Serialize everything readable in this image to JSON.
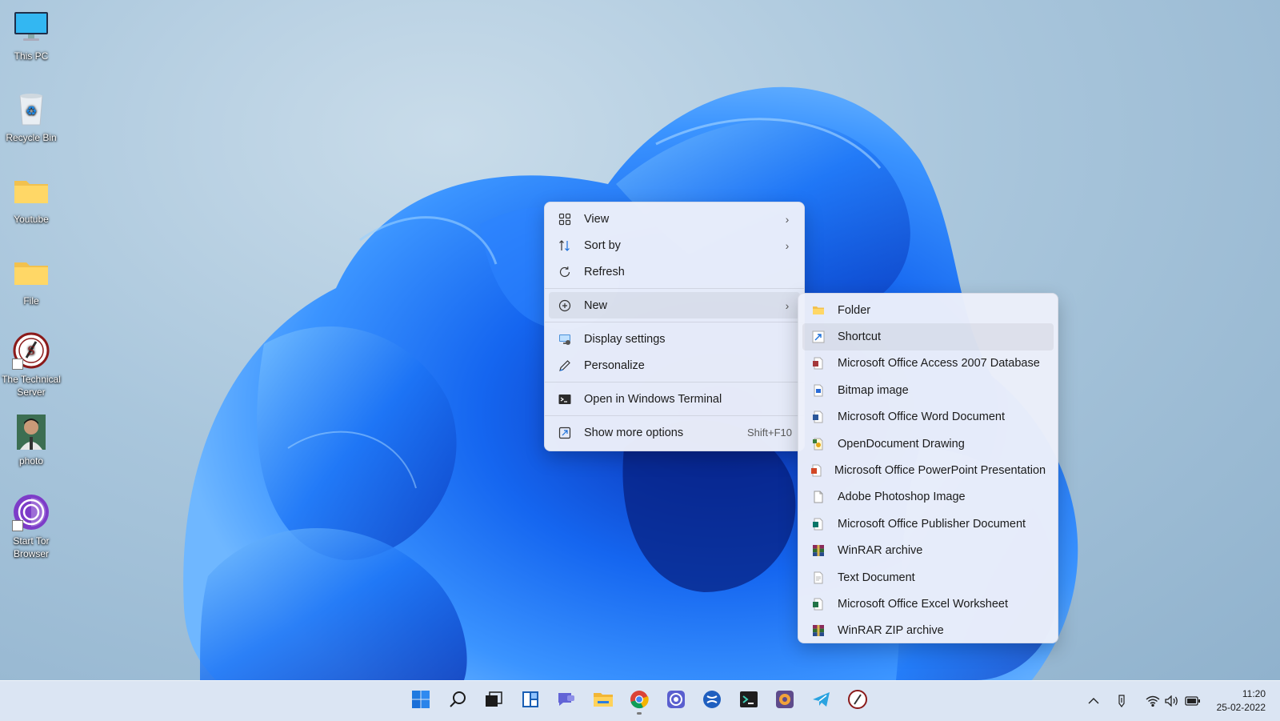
{
  "desktop": {
    "icons": [
      {
        "label": "This PC",
        "icon": "monitor-icon"
      },
      {
        "label": "Recycle Bin",
        "icon": "recycle-bin-icon"
      },
      {
        "label": "Youtube",
        "icon": "folder-icon"
      },
      {
        "label": "File",
        "icon": "folder-icon"
      },
      {
        "label": "The Technical Server",
        "icon": "technical-server-logo-icon"
      },
      {
        "label": "photo",
        "icon": "photo-thumbnail-icon"
      },
      {
        "label": "Start Tor Browser",
        "icon": "tor-browser-icon"
      }
    ]
  },
  "context_menu": {
    "items": [
      {
        "label": "View",
        "icon": "grid-icon",
        "submenu": true
      },
      {
        "label": "Sort by",
        "icon": "sort-icon",
        "submenu": true
      },
      {
        "label": "Refresh",
        "icon": "refresh-icon",
        "submenu": false
      },
      {
        "label": "New",
        "icon": "plus-circle-icon",
        "submenu": true
      },
      {
        "label": "Display settings",
        "icon": "display-icon",
        "submenu": false
      },
      {
        "label": "Personalize",
        "icon": "pen-icon",
        "submenu": false
      },
      {
        "label": "Open in Windows Terminal",
        "icon": "terminal-icon",
        "submenu": false
      },
      {
        "label": "Show more options",
        "icon": "more-options-icon",
        "accelerator": "Shift+F10"
      }
    ]
  },
  "new_submenu": {
    "items": [
      {
        "label": "Folder",
        "icon": "folder-icon"
      },
      {
        "label": "Shortcut",
        "icon": "shortcut-icon"
      },
      {
        "label": "Microsoft Office Access 2007 Database",
        "icon": "access-file-icon"
      },
      {
        "label": "Bitmap image",
        "icon": "bitmap-file-icon"
      },
      {
        "label": "Microsoft Office Word Document",
        "icon": "word-file-icon"
      },
      {
        "label": "OpenDocument Drawing",
        "icon": "opendocument-drawing-icon"
      },
      {
        "label": "Microsoft Office PowerPoint Presentation",
        "icon": "powerpoint-file-icon"
      },
      {
        "label": "Adobe Photoshop Image",
        "icon": "blank-file-icon"
      },
      {
        "label": "Microsoft Office Publisher Document",
        "icon": "publisher-file-icon"
      },
      {
        "label": "WinRAR archive",
        "icon": "winrar-icon"
      },
      {
        "label": "Text Document",
        "icon": "text-file-icon"
      },
      {
        "label": "Microsoft Office Excel Worksheet",
        "icon": "excel-file-icon"
      },
      {
        "label": "WinRAR ZIP archive",
        "icon": "winrar-icon"
      }
    ]
  },
  "taskbar": {
    "apps": [
      "start-icon",
      "search-icon",
      "task-view-icon",
      "widgets-icon",
      "chat-icon",
      "file-explorer-icon",
      "chrome-icon",
      "camera-app-icon",
      "xbox-icon",
      "terminal-icon",
      "media-app-icon",
      "telegram-icon",
      "technical-server-logo-icon"
    ],
    "tray": [
      "chevron-up-icon",
      "pen-input-icon",
      "wifi-icon",
      "volume-icon",
      "battery-icon"
    ],
    "time": "11:20",
    "date": "25-02-2022"
  }
}
